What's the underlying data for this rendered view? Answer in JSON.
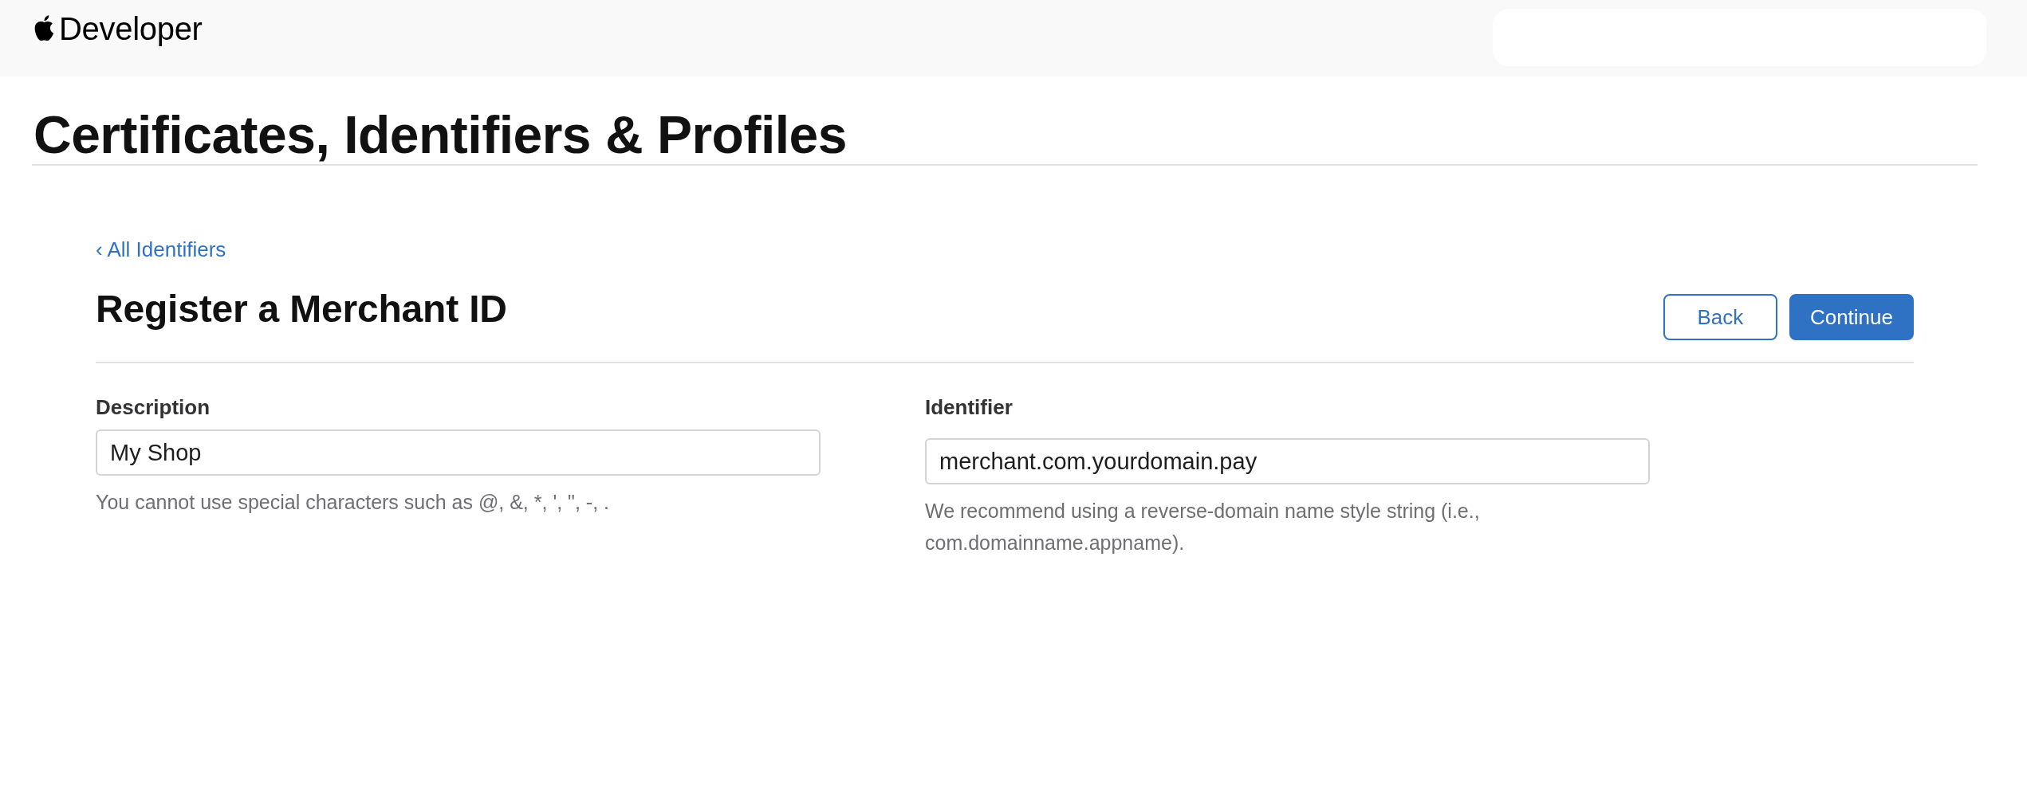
{
  "header": {
    "brand": "Developer"
  },
  "page_title": "Certificates, Identifiers & Profiles",
  "back_link": "‹ All Identifiers",
  "form": {
    "title": "Register a Merchant ID",
    "buttons": [
      {
        "label": "Back",
        "kind": "secondary"
      },
      {
        "label": "Continue",
        "kind": "primary"
      }
    ],
    "fields": [
      {
        "label": "Description",
        "value": "My Shop",
        "help": "You cannot use special characters such as @, &, *, ', \", -, ."
      },
      {
        "label": "Identifier",
        "value": "merchant.com.yourdomain.pay",
        "help": "We recommend using a reverse-domain name style string (i.e., com.domainname.appname)."
      }
    ]
  }
}
